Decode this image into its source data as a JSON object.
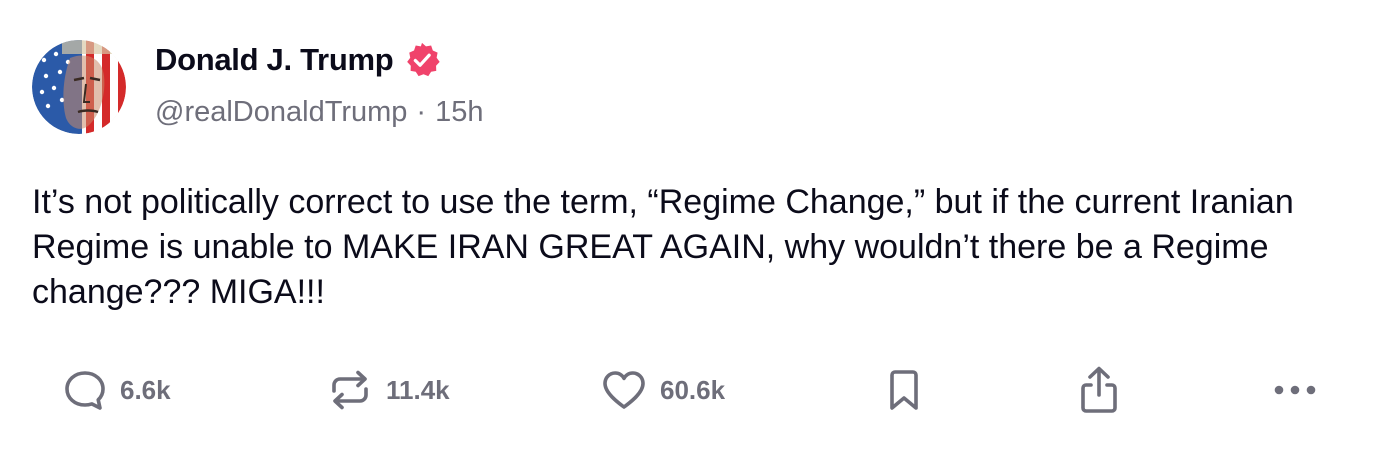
{
  "author": {
    "display_name": "Donald J. Trump",
    "handle": "@realDonaldTrump",
    "time_ago": "15h",
    "separator": "·",
    "verified_color": "#f0436b"
  },
  "post": {
    "text": "It’s not politically correct to use the term, “Regime Change,” but if the current Iranian Regime is unable to MAKE IRAN GREAT AGAIN, why wouldn’t there be a Regime change??? MIGA!!!"
  },
  "actions": {
    "replies": "6.6k",
    "reposts": "11.4k",
    "likes": "60.6k"
  },
  "icons": {
    "reply": "speech-bubble",
    "repost": "repeat-arrows",
    "like": "heart-outline",
    "bookmark": "bookmark-outline",
    "share": "share-up-arrow",
    "more": "ellipsis-horizontal"
  },
  "colors": {
    "icon_gray": "#6e6e7a",
    "text": "#0b0b1a"
  }
}
